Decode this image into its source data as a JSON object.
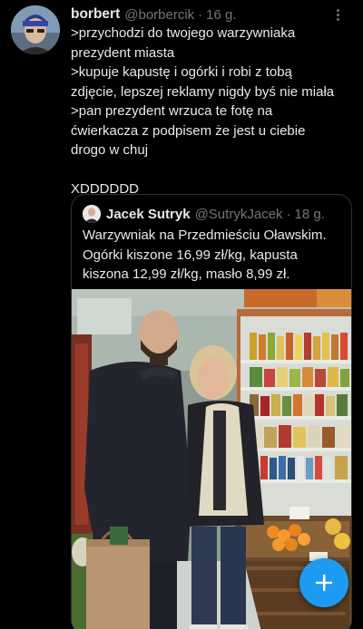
{
  "tweet": {
    "display_name": "borbert",
    "handle": "@borbercik",
    "time": "16 g.",
    "lines": [
      ">przychodzi do twojego warzywniaka",
      "prezydent miasta",
      ">kupuje kapustę i ogórki i robi z tobą",
      "zdjęcie, lepszej reklamy nigdy byś nie miała",
      ">pan prezydent wrzuca te fotę na",
      "ćwierkacza z podpisem że jest u ciebie",
      "drogo w chuj"
    ],
    "last_line": "XDDDDDD"
  },
  "quote": {
    "display_name": "Jacek Sutryk",
    "handle": "@SutrykJacek",
    "time": "18 g.",
    "lines": [
      "Warzywniak na Przedmieściu Oławskim.",
      "Ogórki kiszone 16,99 zł/kg, kapusta",
      "kiszona 12,99 zł/kg, masło 8,99 zł."
    ]
  },
  "colors": {
    "background": "#000000",
    "text": "#e7e9ea",
    "secondary": "#71767b",
    "border": "#2f3336",
    "accent": "#1d9bf0"
  },
  "icons": {
    "more": "more-dots-icon",
    "compose": "plus-icon"
  }
}
